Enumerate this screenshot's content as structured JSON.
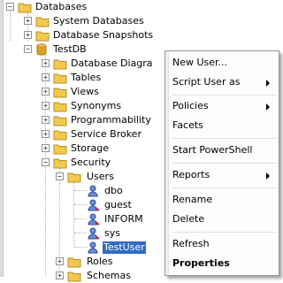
{
  "tree": {
    "databases": "Databases",
    "system_databases": "System Databases",
    "database_snapshots": "Database Snapshots",
    "testdb": "TestDB",
    "database_diagrams": "Database Diagra",
    "tables": "Tables",
    "views": "Views",
    "synonyms": "Synonyms",
    "programmability": "Programmability",
    "service_broker": "Service Broker",
    "storage": "Storage",
    "security": "Security",
    "users": "Users",
    "user_dbo": "dbo",
    "user_guest": "guest",
    "user_information": "INFORM",
    "user_sys": "sys",
    "user_testuser": "TestUser",
    "roles": "Roles",
    "schemas": "Schemas"
  },
  "context_menu": {
    "new_user": "New User...",
    "script_user_as": "Script User as",
    "policies": "Policies",
    "facets": "Facets",
    "start_powershell": "Start PowerShell",
    "reports": "Reports",
    "rename": "Rename",
    "delete": "Delete",
    "refresh": "Refresh",
    "properties": "Properties"
  },
  "colors": {
    "selection": "#316ac5",
    "folder": "#f2c94c",
    "database": "#d9a521"
  }
}
